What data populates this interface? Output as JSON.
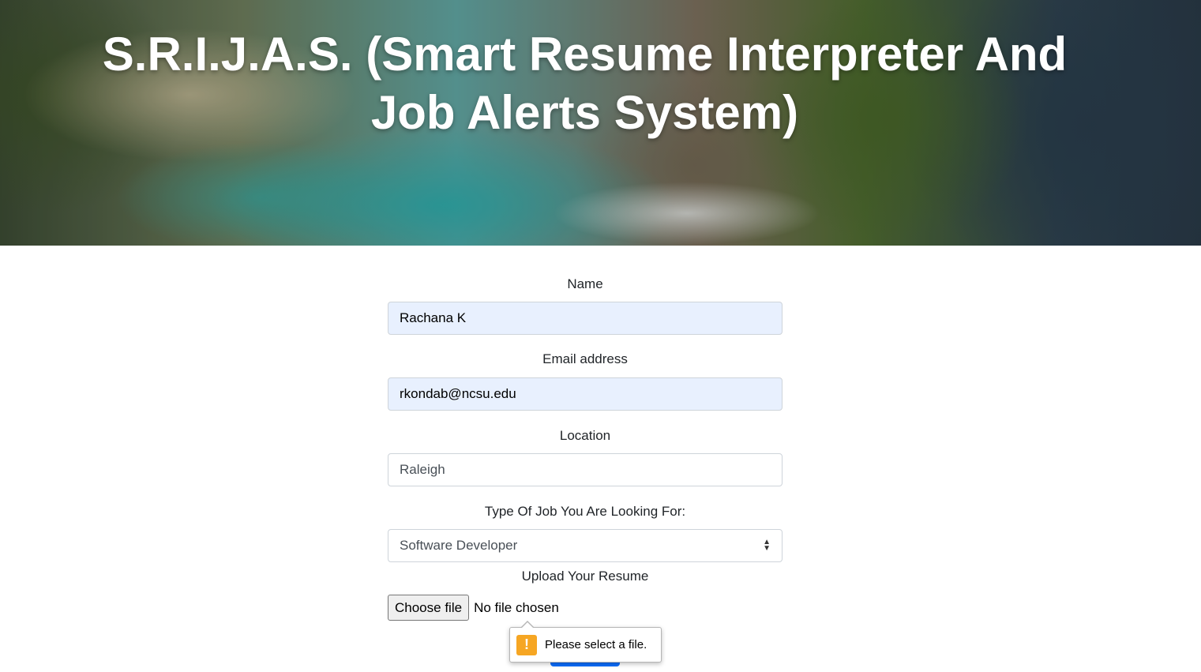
{
  "header": {
    "title": "S.R.I.J.A.S. (Smart Resume Interpreter And Job Alerts System)"
  },
  "form": {
    "name": {
      "label": "Name",
      "value": "Rachana K"
    },
    "email": {
      "label": "Email address",
      "value": "rkondab@ncsu.edu"
    },
    "location": {
      "label": "Location",
      "value": "Raleigh"
    },
    "job_type": {
      "label": "Type Of Job You Are Looking For:",
      "selected": "Software Developer"
    },
    "resume": {
      "label": "Upload Your Resume",
      "button_label": "Choose file",
      "status": "No file chosen"
    }
  },
  "validation": {
    "message": "Please select a file.",
    "icon": "warning-icon",
    "icon_glyph": "!"
  },
  "colors": {
    "autofill_bg": "#e8f0fe",
    "submit": "#0d6efd",
    "warning": "#f6a623"
  }
}
